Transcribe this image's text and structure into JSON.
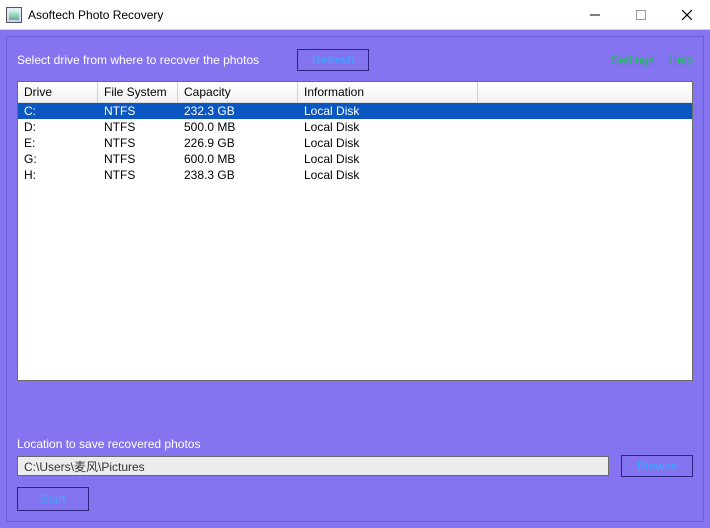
{
  "window": {
    "title": "Asoftech Photo Recovery"
  },
  "topbar": {
    "instruction": "Select drive from where to recover the photos",
    "refresh_label": "Refresh",
    "links": {
      "settings": "Settings",
      "help": "Help"
    }
  },
  "drive_table": {
    "columns": [
      "Drive",
      "File System",
      "Capacity",
      "Information"
    ],
    "rows": [
      {
        "drive": "C:",
        "fs": "NTFS",
        "capacity": "232.3 GB",
        "info": "Local Disk",
        "selected": true
      },
      {
        "drive": "D:",
        "fs": "NTFS",
        "capacity": "500.0 MB",
        "info": "Local Disk",
        "selected": false
      },
      {
        "drive": "E:",
        "fs": "NTFS",
        "capacity": "226.9 GB",
        "info": "Local Disk",
        "selected": false
      },
      {
        "drive": "G:",
        "fs": "NTFS",
        "capacity": "600.0 MB",
        "info": "Local Disk",
        "selected": false
      },
      {
        "drive": "H:",
        "fs": "NTFS",
        "capacity": "238.3 GB",
        "info": "Local Disk",
        "selected": false
      }
    ]
  },
  "location": {
    "label": "Location to save recovered photos",
    "path": "C:\\Users\\麦风\\Pictures",
    "browse_label": "Browse"
  },
  "actions": {
    "start_label": "Start"
  }
}
